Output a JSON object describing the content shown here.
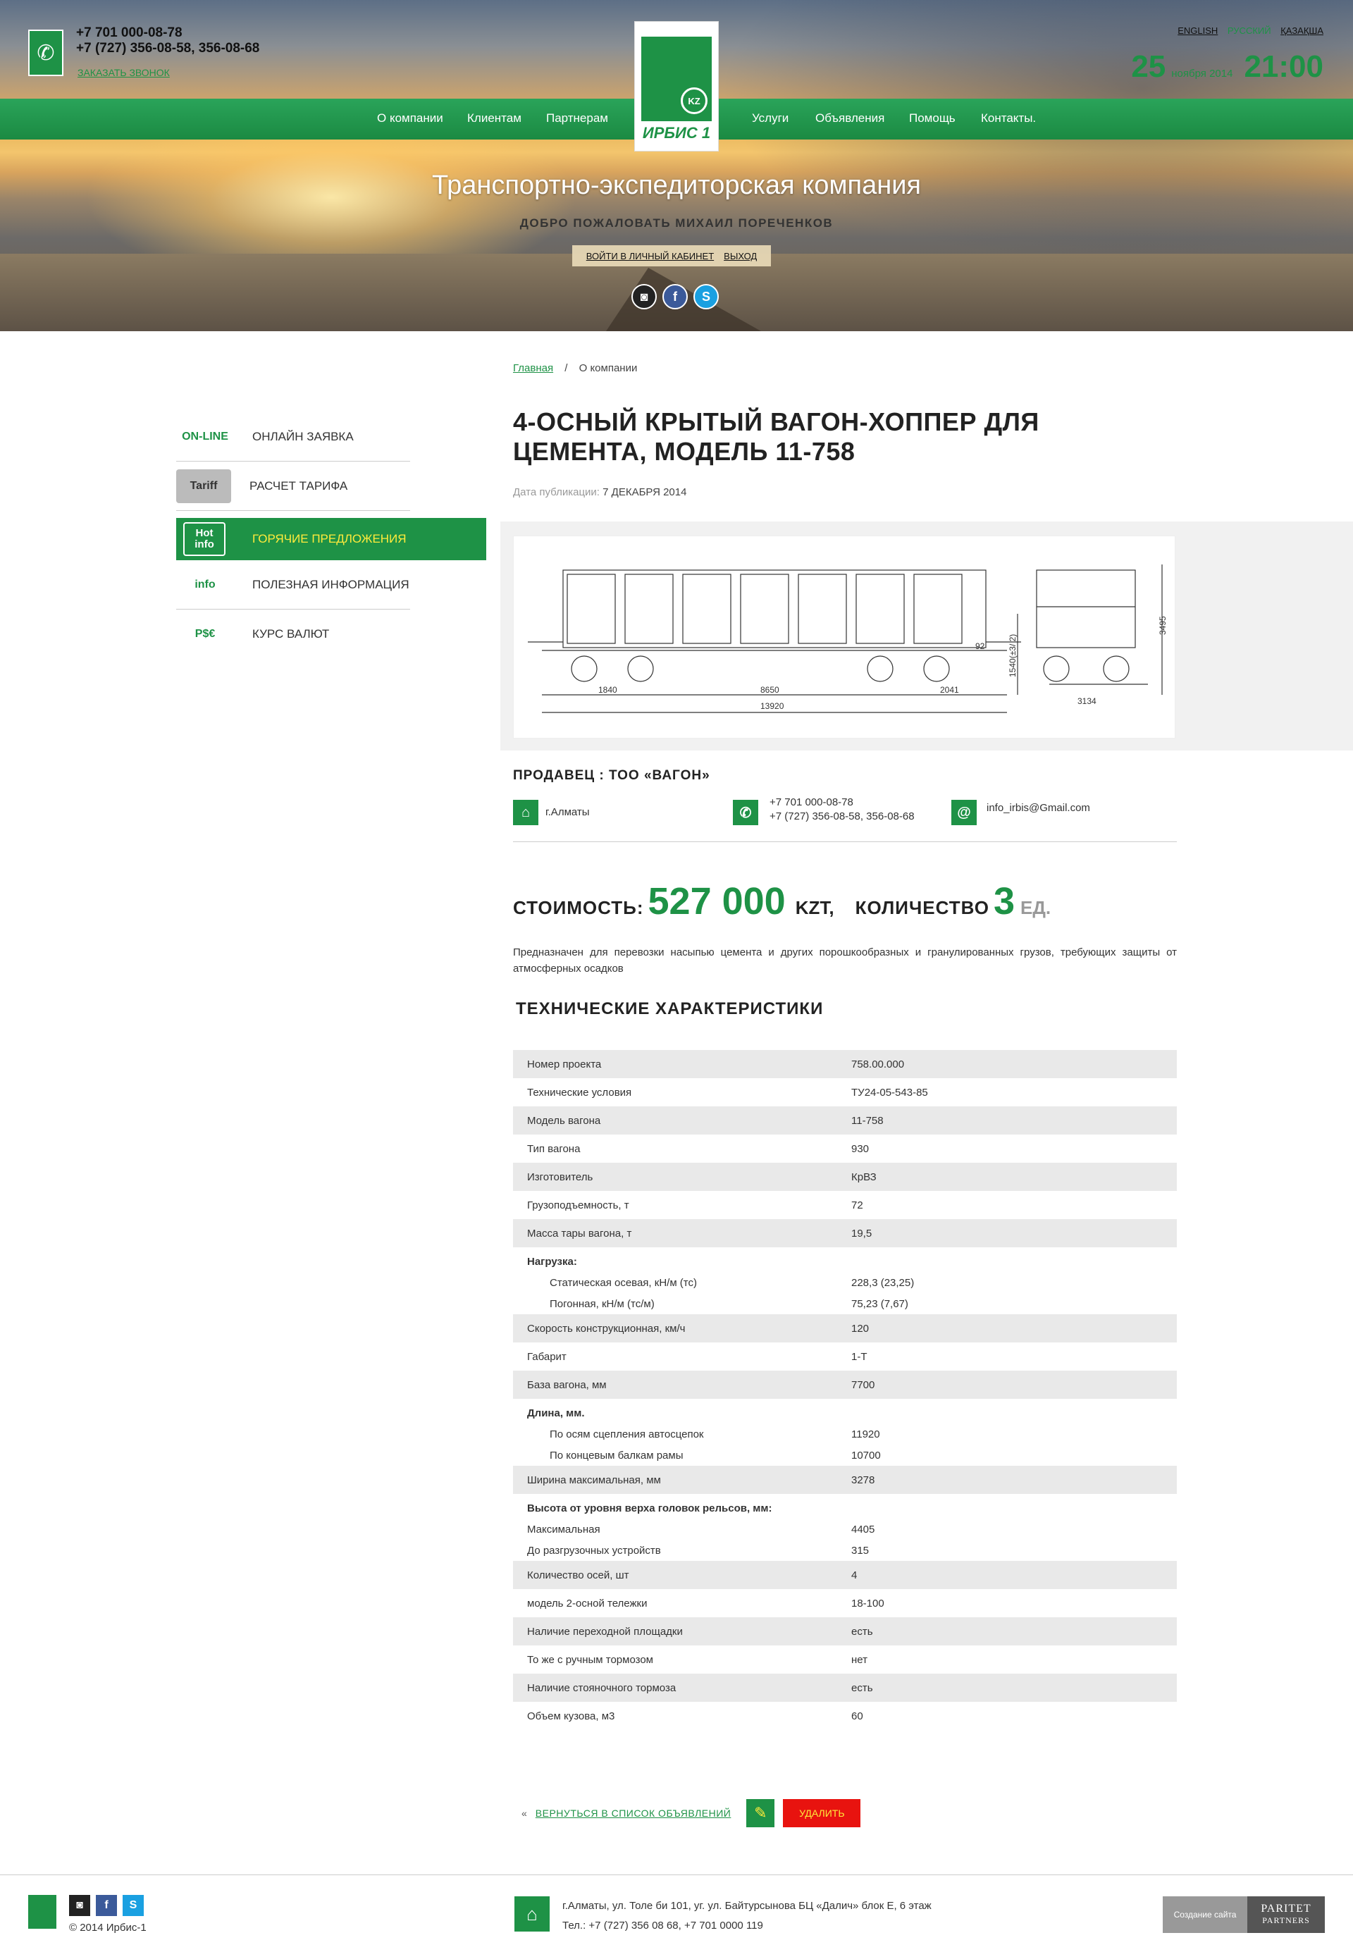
{
  "header": {
    "phone_1": "+7 701 000-08-78",
    "phone_2": "+7 (727) 356-08-58, 356-08-68",
    "callback": "ЗАКАЗАТЬ ЗВОНОК",
    "logo_text": "ИРБИС 1",
    "languages": [
      "ENGLISH",
      "РУССКИЙ",
      "ҚАЗАҚША"
    ],
    "active_language": "РУССКИЙ",
    "date_day": "25",
    "date_month": "ноября 2014",
    "time": "21:00",
    "nav": [
      "О компании",
      "Клиентам",
      "Партнерам",
      "Услуги",
      "Объявления",
      "Помощь",
      "Контакты."
    ],
    "hero_title": "Транспортно-экспедиторская компания",
    "welcome": "ДОБРО ПОЖАЛОВАТЬ МИХАИЛ ПОРЕЧЕНКОВ",
    "login_link": "ВОЙТИ В ЛИЧНЫЙ КАБИНЕТ",
    "logout_link": "ВЫХОД"
  },
  "breadcrumb": {
    "home": "Главная",
    "sep": "/",
    "current": "О компании"
  },
  "sidebar": {
    "items": [
      {
        "icon": "ON-LINE",
        "label": "ОНЛАЙН ЗАЯВКА"
      },
      {
        "icon": "Tariff",
        "label": "РАСЧЕТ ТАРИФА"
      },
      {
        "icon": "Hot info",
        "label": "ГОРЯЧИЕ ПРЕДЛОЖЕНИЯ"
      },
      {
        "icon": "info",
        "label": "ПОЛЕЗНАЯ ИНФОРМАЦИЯ"
      },
      {
        "icon": "P$€",
        "label": "КУРС ВАЛЮТ"
      }
    ]
  },
  "ad": {
    "title": "4-ОСНЫЙ КРЫТЫЙ ВАГОН-ХОППЕР ДЛЯ ЦЕМЕНТА, МОДЕЛЬ 11-758",
    "pub_label": "Дата публикации:",
    "pub_date": "7 ДЕКАБРЯ 2014",
    "seller": "ПРОДАВЕЦ : ТОО «ВАГОН»",
    "city": "г.Алматы",
    "contact_phone_1": "+7 701 000-08-78",
    "contact_phone_2": "+7 (727) 356-08-58, 356-08-68",
    "email": "info_irbis@Gmail.com",
    "price_label": "СТОИМОСТЬ:",
    "price": "527 000",
    "currency": "KZT,",
    "qty_label": "КОЛИЧЕСТВО",
    "qty": "3",
    "qty_unit": "ЕД.",
    "description": "Предназначен для перевозки насыпью цемента и других порошкообразных и гранулированных грузов, требующих защиты от атмосферных осадков",
    "tech_title": "ТЕХНИЧЕСКИЕ ХАРАКТЕРИСТИКИ",
    "back_link": "ВЕРНУТЬСЯ В СПИСОК ОБЪЯВЛЕНИЙ",
    "delete": "УДАЛИТЬ"
  },
  "specs": {
    "r1": {
      "k": "Номер проекта",
      "v": "758.00.000"
    },
    "r2": {
      "k": "Технические условия",
      "v": "ТУ24-05-543-85"
    },
    "r3": {
      "k": "Модель вагона",
      "v": "11-758"
    },
    "r4": {
      "k": "Тип вагона",
      "v": "930"
    },
    "r5": {
      "k": "Изготовитель",
      "v": "КрВЗ"
    },
    "r6": {
      "k": "Грузоподъемность, т",
      "v": "72"
    },
    "r7": {
      "k": "Масса тары вагона, т",
      "v": "19,5"
    },
    "g1": "Нагрузка:",
    "g1a": {
      "k": "Статическая осевая, кН/м (тс)",
      "v": "228,3 (23,25)"
    },
    "g1b": {
      "k": "Погонная, кН/м (тс/м)",
      "v": "75,23 (7,67)"
    },
    "r8": {
      "k": "Скорость конструкционная, км/ч",
      "v": "120"
    },
    "r9": {
      "k": "Габарит",
      "v": "1-Т"
    },
    "r10": {
      "k": "База вагона, мм",
      "v": "7700"
    },
    "g2": "Длина, мм.",
    "g2a": {
      "k": "По осям сцепления автосцепок",
      "v": "11920"
    },
    "g2b": {
      "k": "По концевым балкам рамы",
      "v": "10700"
    },
    "r11": {
      "k": "Ширина максимальная, мм",
      "v": "3278"
    },
    "g3": "Высота от уровня верха головок рельсов, мм:",
    "g3a": {
      "k": "Максимальная",
      "v": "4405"
    },
    "g3b": {
      "k": "До разгрузочных устройств",
      "v": "315"
    },
    "r12": {
      "k": "Количество осей, шт",
      "v": "4"
    },
    "r13": {
      "k": "модель 2-осной тележки",
      "v": "18-100"
    },
    "r14": {
      "k": "Наличие переходной площадки",
      "v": "есть"
    },
    "r15": {
      "k": "То же с ручным тормозом",
      "v": "нет"
    },
    "r16": {
      "k": "Наличие стояночного тормоза",
      "v": "есть"
    },
    "r17": {
      "k": "Объем кузова, м3",
      "v": "60"
    }
  },
  "drawing_dims": [
    "1840",
    "8650",
    "13920",
    "2041",
    "3495",
    "1540(±3/ 2)",
    "3134",
    "92"
  ],
  "footer": {
    "copyright": "© 2014  Ирбис-1",
    "address": "г.Алматы, ул. Толе би 101, уг. ул. Байтурсынова БЦ «Далич» блок Е, 6 этаж",
    "phones": "Тел.: +7 (727) 356 08 68, +7 701 0000 119",
    "credit_label": "Создание сайта",
    "credit_brand_1": "PARITET",
    "credit_brand_2": "PARTNERS"
  },
  "colors": {
    "brand_green": "#1e9246",
    "delete_red": "#e8130f",
    "accent_yellow": "#ffeb3b"
  }
}
